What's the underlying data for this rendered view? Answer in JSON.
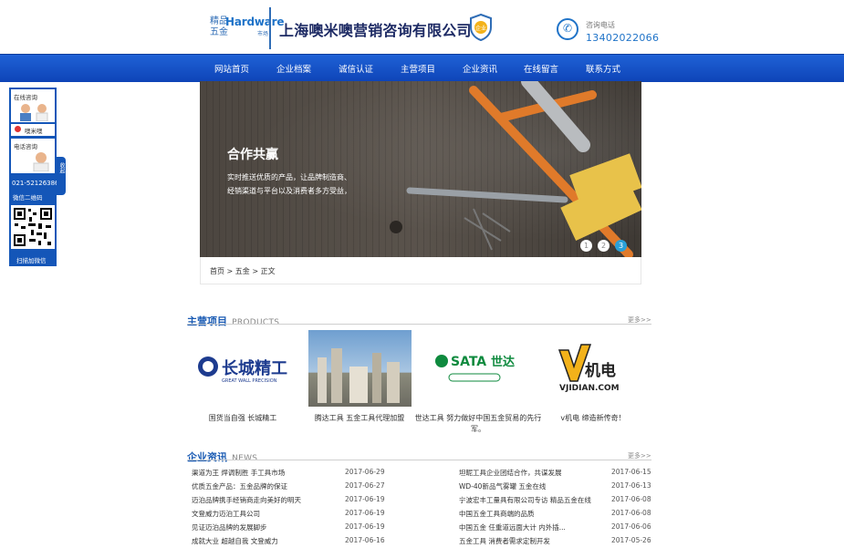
{
  "header": {
    "logo": {
      "cn_top": "精品",
      "cn_bottom": "五金",
      "en": "Hardware",
      "tag": "市场"
    },
    "company_name": "上海噢米噢营销咨询有限公司",
    "badge_text": "企业",
    "phone_label": "咨询电话",
    "phone_number": "13402022066"
  },
  "nav": [
    "网站首页",
    "企业档案",
    "诚信认证",
    "主营项目",
    "企业资讯",
    "在线留言",
    "联系方式"
  ],
  "side_panel": {
    "online_label": "在线咨询",
    "agent_name": "噢米噢",
    "phone_label": "电话咨询",
    "phone": "021-52126386",
    "wechat_label": "微信二维码",
    "scan_label": "扫描加微信",
    "tab_label": "收起"
  },
  "banner": {
    "title": "合作共赢",
    "lines": [
      "实时推送优质的产品，让品牌制造商、",
      "经销渠道与平台以及消费者多方受益，"
    ],
    "dots": [
      "1",
      "2",
      "3"
    ],
    "active_dot": 3
  },
  "breadcrumb": [
    "首页",
    ">",
    "五金",
    ">",
    "正文"
  ],
  "products": {
    "title_cn": "主营项目",
    "title_en": "PRODUCTS",
    "more": "更多>>",
    "items": [
      {
        "caption": "国货当自强 长城精工",
        "logo_cn": "长城精工",
        "logo_en": "GREAT WALL PRECISION"
      },
      {
        "caption": "腾达工具 五金工具代理加盟"
      },
      {
        "caption": "世达工具 努力做好中国五金贸易的先行军。",
        "logo_cn": "世达",
        "logo_en": "SATA"
      },
      {
        "caption": "v机电 缔造新传奇！",
        "logo_cn": "机电",
        "logo_en": "VJIDIAN.COM"
      }
    ]
  },
  "news": {
    "title_cn": "企业资讯",
    "title_en": "NEWS",
    "more": "更多>>",
    "left": [
      {
        "title": "渠道为王 焊调制胜 手工具市场",
        "date": "2017-06-29"
      },
      {
        "title": "优质五金产品：五金品牌的保证",
        "date": "2017-06-27"
      },
      {
        "title": "迈泊品牌携手经销商走向美好的明天",
        "date": "2017-06-19"
      },
      {
        "title": "文登威力迈泊工具公司",
        "date": "2017-06-19"
      },
      {
        "title": "见证迈泊品牌的发展脚步",
        "date": "2017-06-19"
      },
      {
        "title": "成就大业 超越自我 文登威力",
        "date": "2017-06-16"
      }
    ],
    "right": [
      {
        "title": "坦昵工具企业团结合作，共谋发展",
        "date": "2017-06-15"
      },
      {
        "title": "WD-40新品气雾罐 五金在线",
        "date": "2017-06-13"
      },
      {
        "title": "宁波宏丰工量具有限公司专访 精品五金在线",
        "date": "2017-06-08"
      },
      {
        "title": "中国五金工具商端的品质",
        "date": "2017-06-08"
      },
      {
        "title": "中国五金 任重道远面大计 内外插...",
        "date": "2017-06-06"
      },
      {
        "title": "五金工具 消费者需求定制开发",
        "date": "2017-05-26"
      }
    ]
  }
}
